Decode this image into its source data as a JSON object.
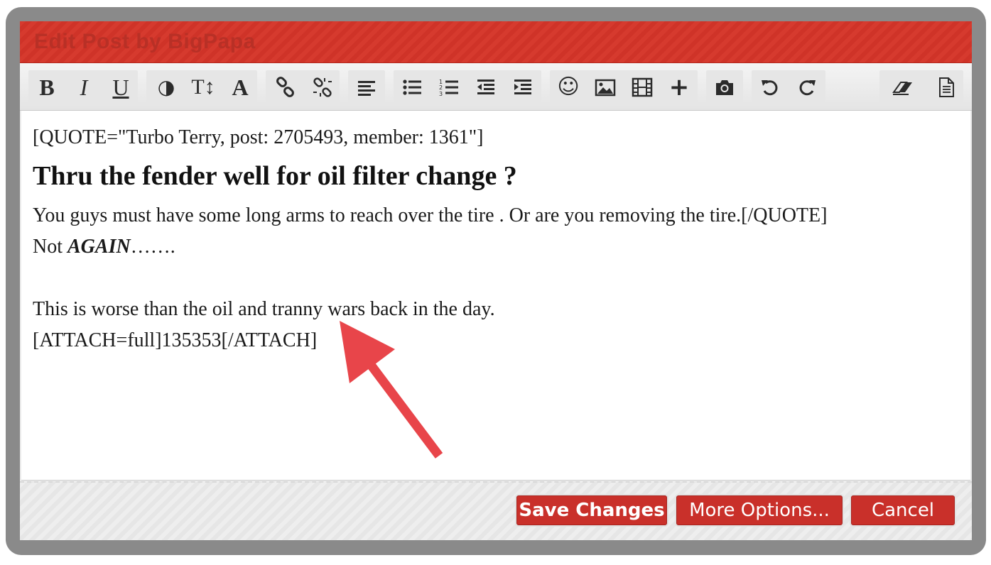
{
  "dialog": {
    "title": "Edit Post by BigPapa"
  },
  "toolbar": {
    "bold_label": "B",
    "italic_label": "I",
    "underline_label": "U",
    "text_color_label": "◑",
    "font_size_label": "T↕",
    "font_family_label": "A",
    "smilie_label": "☺",
    "insert_label": "+",
    "icons": [
      "bold",
      "italic",
      "underline",
      "text-color",
      "font-size",
      "font-family",
      "link",
      "unlink",
      "align",
      "bullet-list",
      "numbered-list",
      "outdent",
      "indent",
      "smilie",
      "image",
      "media",
      "insert",
      "camera",
      "undo",
      "redo",
      "eraser",
      "document"
    ]
  },
  "editor": {
    "lines": [
      "[QUOTE=\"Turbo Terry, post: 2705493, member: 1361\"]",
      "Thru the fender well for oil filter change ?",
      "You guys must have some long arms to reach over the tire . Or are you removing the tire.[/QUOTE]",
      "Not ",
      "AGAIN",
      "…….",
      "This is worse than the oil and tranny wars back in the day.",
      "[ATTACH=full]135353[/ATTACH]"
    ]
  },
  "footer": {
    "save_label": "Save Changes",
    "more_label": "More Options...",
    "cancel_label": "Cancel"
  },
  "colors": {
    "accent_red": "#c9302a",
    "title_red": "#d63a2e",
    "arrow_red": "#e8454a",
    "frame_gray": "#8a8a8a"
  }
}
